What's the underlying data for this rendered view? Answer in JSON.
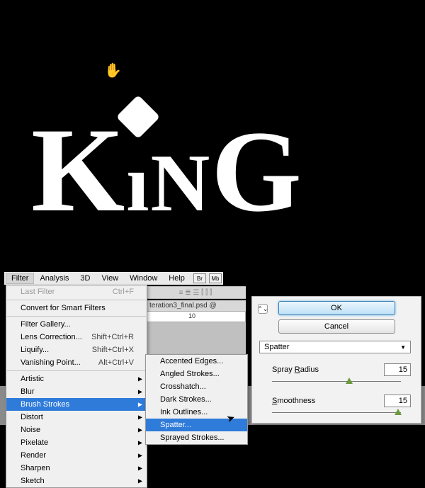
{
  "canvas_text": {
    "k": "K",
    "i": "ı",
    "n": "N",
    "g": "G"
  },
  "menubar": {
    "items": [
      "Filter",
      "Analysis",
      "3D",
      "View",
      "Window",
      "Help"
    ],
    "br": "Br",
    "mb": "Mb"
  },
  "doc_tab": "teration3_final.psd @",
  "ruler_label": "10",
  "options_glyphs": "≡ ≣ ☰ ⫿ ⫿ ⫿",
  "menu": {
    "last_filter": "Last Filter",
    "last_filter_sc": "Ctrl+F",
    "convert": "Convert for Smart Filters",
    "filter_gallery": "Filter Gallery...",
    "lens": "Lens Correction...",
    "lens_sc": "Shift+Ctrl+R",
    "liquify": "Liquify...",
    "liquify_sc": "Shift+Ctrl+X",
    "vanish": "Vanishing Point...",
    "vanish_sc": "Alt+Ctrl+V",
    "cats": [
      "Artistic",
      "Blur",
      "Brush Strokes",
      "Distort",
      "Noise",
      "Pixelate",
      "Render",
      "Sharpen",
      "Sketch"
    ]
  },
  "submenu": {
    "items": [
      "Accented Edges...",
      "Angled Strokes...",
      "Crosshatch...",
      "Dark Strokes...",
      "Ink Outlines...",
      "Spatter...",
      "Sprayed Strokes..."
    ]
  },
  "dialog": {
    "ok": "OK",
    "cancel": "Cancel",
    "select": "Spatter",
    "spray_label_u": "R",
    "spray_label_pre": "Spray ",
    "spray_label_post": "adius",
    "spray_value": "15",
    "smooth_label_u": "S",
    "smooth_label_post": "moothness",
    "smooth_value": "15"
  }
}
